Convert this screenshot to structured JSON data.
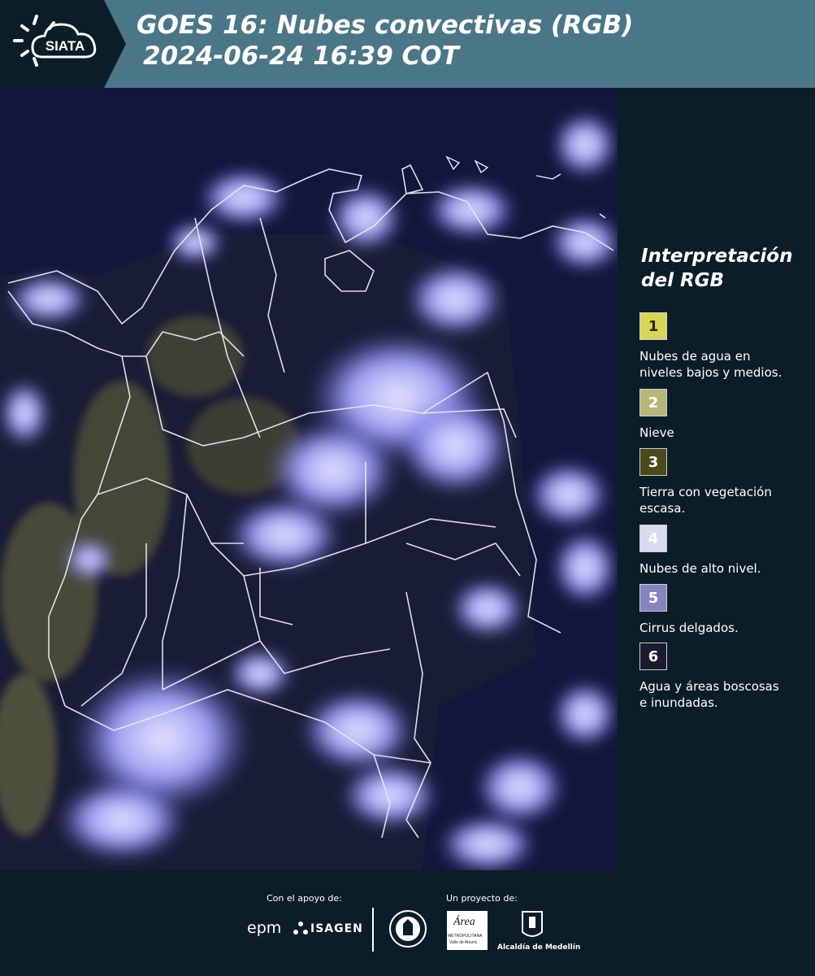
{
  "header": {
    "logo_text": "SIATA",
    "title_line1": "GOES 16: Nubes convectivas (RGB)",
    "title_line2": "2024-06-24 16:39 COT"
  },
  "legend": {
    "title_line1": "Interpretación",
    "title_line2": "del RGB",
    "items": [
      {
        "number": "1",
        "color": "#d9d657",
        "text_color": "#2a2a10",
        "label_line1": "Nubes de agua en",
        "label_line2": "niveles bajos y medios."
      },
      {
        "number": "2",
        "color": "#b9b679",
        "text_color": "#ffffff",
        "label_line1": "Nieve",
        "label_line2": ""
      },
      {
        "number": "3",
        "color": "#4c4a1a",
        "text_color": "#ffffff",
        "label_line1": "Tierra con vegetación",
        "label_line2": "escasa."
      },
      {
        "number": "4",
        "color": "#d9d9f2",
        "text_color": "#ffffff",
        "label_line1": "Nubes de alto nivel.",
        "label_line2": ""
      },
      {
        "number": "5",
        "color": "#8585c2",
        "text_color": "#ffffff",
        "label_line1": "Cirrus delgados.",
        "label_line2": ""
      },
      {
        "number": "6",
        "color": "#1b1a30",
        "text_color": "#ffffff",
        "label_line1": "Agua y áreas boscosas",
        "label_line2": "e inundadas."
      }
    ]
  },
  "footer": {
    "support_label": "Con el apoyo de:",
    "project_label": "Un proyecto de:",
    "sponsor_epm": "epm",
    "sponsor_isagen": "ISAGEN",
    "area_text": "Área",
    "area_sub1": "METROPOLITANA",
    "area_sub2": "Valle de Aburrá",
    "alcaldia": "Alcaldía de Medellín"
  }
}
